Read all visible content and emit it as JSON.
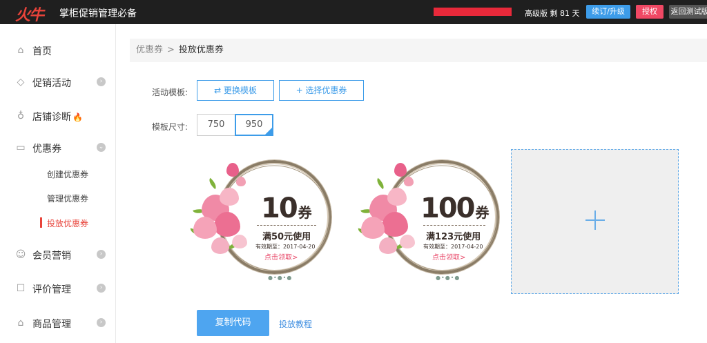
{
  "topbar": {
    "logo": "火牛",
    "title": "掌柜促销管理必备",
    "plan_text": "高级版 剩 81 天",
    "renew_label": "续订/升级",
    "auth_label": "授权",
    "test_label": "返回测试版"
  },
  "sidebar": {
    "items": [
      {
        "label": "首页",
        "icon": "home-icon"
      },
      {
        "label": "促销活动",
        "icon": "tag-icon"
      },
      {
        "label": "店铺诊断",
        "icon": "stethoscope-icon"
      },
      {
        "label": "优惠券",
        "icon": "wallet-icon"
      },
      {
        "label": "会员营销",
        "icon": "user-icon"
      },
      {
        "label": "评价管理",
        "icon": "comment-icon"
      },
      {
        "label": "商品管理",
        "icon": "shop-icon"
      }
    ],
    "coupon_sub": [
      "创建优惠券",
      "管理优惠券",
      "投放优惠券"
    ]
  },
  "breadcrumb": {
    "parent": "优惠券",
    "sep": ">",
    "current": "投放优惠券"
  },
  "form": {
    "template_label": "活动模板:",
    "change_template": "⇄ 更换模板",
    "select_coupon": "+ 选择优惠券",
    "size_label": "模板尺寸:",
    "size_750": "750",
    "size_950": "950",
    "selected_size": "950"
  },
  "coupons": [
    {
      "amount": "10",
      "unit": "券",
      "condition": "满50元使用",
      "valid": "有效期至：2017-04-20",
      "claim": "点击领取>"
    },
    {
      "amount": "100",
      "unit": "券",
      "condition": "满123元使用",
      "valid": "有效期至：2017-04-20",
      "claim": "点击领取>"
    }
  ],
  "actions": {
    "copy_code": "复制代码",
    "tutorial": "投放教程"
  },
  "colors": {
    "accent_blue": "#3d9ce9",
    "accent_red": "#e8433a",
    "topbar_bg": "#1f1f1f"
  }
}
